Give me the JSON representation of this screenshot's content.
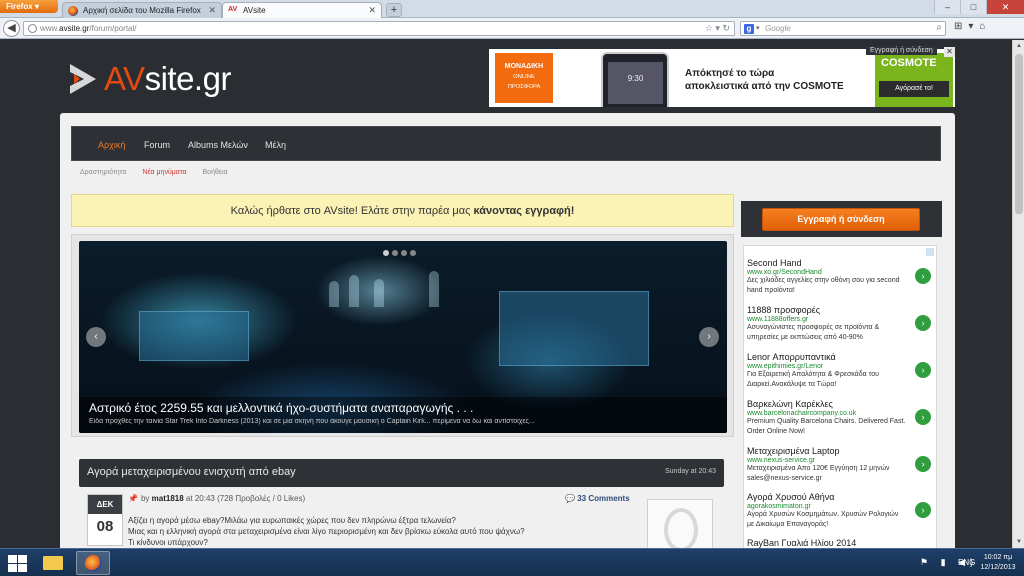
{
  "browser": {
    "app_button": "Firefox",
    "tabs": [
      {
        "title": "Αρχική σελίδα του Mozilla Firefox",
        "active": false
      },
      {
        "title": "AVsite",
        "favicon_text": "AV",
        "active": true
      }
    ],
    "window_buttons": {
      "minimize": "–",
      "maximize": "□",
      "close": "✕"
    },
    "url_prefix": "www.",
    "url_domain": "avsite.gr",
    "url_path": "/forum/portal/",
    "search_engine": "g",
    "search_placeholder": "Google"
  },
  "site": {
    "logo_prefix": "AV",
    "logo_suffix": "site.gr",
    "top_ad": {
      "badge_title": "ΜΟΝΑΔΙΚΗ",
      "badge_sub1": "ONLINE",
      "badge_sub2": "ΠΡΟΣΦΟΡΑ",
      "phone_screen": "9:30",
      "headline_line1": "Απόκτησέ το τώρα",
      "headline_line2": "αποκλειστικά από την COSMOTE",
      "brand": "COSMOTE",
      "buy_label": "Αγόρασέ το!",
      "corner_tab": "Εγγραφή ή σύνδεση",
      "close": "✕"
    },
    "main_nav": [
      {
        "label": "Αρχική",
        "active": true
      },
      {
        "label": "Forum",
        "active": false
      },
      {
        "label": "Albums Μελών",
        "active": false
      },
      {
        "label": "Μέλη",
        "active": false
      }
    ],
    "sub_nav": [
      {
        "label": "Δραστηριότητα",
        "hot": false
      },
      {
        "label": "Νέα μηνύματα",
        "hot": true
      },
      {
        "label": "Βοήθεια",
        "hot": false
      }
    ],
    "welcome_text": "Καλώς ήρθατε στο AVsite! Ελάτε στην παρέα μας ",
    "welcome_link": "κάνοντας εγγραφή!",
    "slider": {
      "title": "Αστρικό έτος 2259.55 και μελλοντικά ήχο-συστήματα αναπαραγωγής . . .",
      "subtitle": "Είδα προχθές την ταινία Star Trek Into Darkness (2013) και σε μια σκηνή που άκουγε μουσική ο Captain Kirk... περίμενα να δω και αντίστοιχες...",
      "prev": "‹",
      "next": "›"
    },
    "post": {
      "title": "Αγορά μεταχειρισμένου ενισχυτή από ebay",
      "posted_time": "Sunday at 20:43",
      "month": "ΔΕΚ",
      "day": "08",
      "by_label": "by",
      "author": "mat1818",
      "at_label": "at",
      "time": "20:43",
      "stats": "(728 Προβολές / 0 Likes)",
      "comments": "33 Comments",
      "body_line1": "Αξίζει η αγορά μέσω ebay?Μιλάω για ευρωπαικές χώρες που δεν πληρώνω έξτρα τελωνεία?",
      "body_line2": "Μιας και η ελληνική αγορά στα μεταχειρισμένα είναι λίγο περιορισμένη και δεν βρίσκω εύκολα αυτό που ψάχνω?",
      "body_line3": "Τι κίνδυνοι υπάρχουν?"
    },
    "register_button": "Εγγραφή ή σύνδεση",
    "side_ads": [
      {
        "title": "Second Hand",
        "url": "www.xo.gr/SecondHand",
        "desc": "Δες χιλιάδες αγγελίες στην οθόνη σου για second hand προϊόντα!"
      },
      {
        "title": "11888 προσφορές",
        "url": "www.11888offers.gr",
        "desc": "Ασυναγώνιστες προσφορές σε προϊόντα & υπηρεσίες με εκπτώσεις από 40-90%"
      },
      {
        "title": "Lenor Απορρυπαντικά",
        "url": "www.epithimies.gr/Lenor",
        "desc": "Για Εξαιρετική Απαλότητα & Φρεσκάδα του Διαρκεί.Ανακάλυψε τα Τώρα!"
      },
      {
        "title": "Βαρκελώνη Καρέκλες",
        "url": "www.barcelonachaircompany.co.uk",
        "desc": "Premium Quality Barcelona Chairs. Delivered Fast. Order Online Now!"
      },
      {
        "title": "Μεταχειρισμένα Laptop",
        "url": "www.nexus-service.gr",
        "desc": "Μεταχειρισμένα Απο 120€ Εγγύηση 12 μηνών sales@nexus-service.gr"
      },
      {
        "title": "Αγορά Χρυσού Αθήνα",
        "url": "agorakosmimaton.gr",
        "desc": "Αγορά Χρυσών Κοσμημάτων, Χρυσών Ρολογιών με Δικαίωμα Επαναγοράς!"
      },
      {
        "title": "RayBan Γυαλιά Ηλίου 2014",
        "url": "",
        "desc": ""
      }
    ]
  },
  "taskbar": {
    "language": "ENG",
    "time": "10:02 πμ",
    "date": "12/12/2013"
  },
  "colors": {
    "accent": "#e24a12",
    "nav_active": "#f07a1e",
    "welcome_bg": "#fbf2b5"
  }
}
